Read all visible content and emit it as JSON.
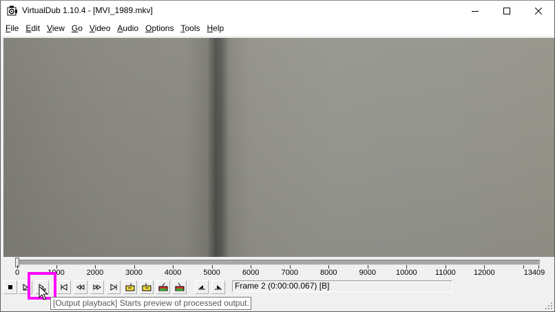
{
  "window": {
    "title": "VirtualDub 1.10.4 - [MVI_1989.mkv]",
    "app_icon": "virtualdub-icon",
    "min_icon": "minimize-icon",
    "max_icon": "maximize-icon",
    "close_icon": "close-icon"
  },
  "menu": [
    {
      "label": "File",
      "accel": "F",
      "rest": "ile"
    },
    {
      "label": "Edit",
      "accel": "E",
      "rest": "dit"
    },
    {
      "label": "View",
      "accel": "V",
      "rest": "iew"
    },
    {
      "label": "Go",
      "accel": "G",
      "rest": "o"
    },
    {
      "label": "Video",
      "accel": "V",
      "rest": "ideo"
    },
    {
      "label": "Audio",
      "accel": "A",
      "rest": "udio"
    },
    {
      "label": "Options",
      "accel": "O",
      "rest": "ptions"
    },
    {
      "label": "Tools",
      "accel": "T",
      "rest": "ools"
    },
    {
      "label": "Help",
      "accel": "H",
      "rest": "elp"
    }
  ],
  "timeline": {
    "current_frame": 2,
    "total_frames": 13409,
    "tick_labels": [
      "0",
      "1000",
      "2000",
      "3000",
      "4000",
      "5000",
      "6000",
      "7000",
      "8000",
      "9000",
      "10000",
      "11000",
      "12000",
      "13409"
    ]
  },
  "toolbar": {
    "buttons": [
      {
        "name": "stop-button",
        "icon": "stop-icon",
        "glyph": "■"
      },
      {
        "name": "input-playback-button",
        "icon": "play-input-icon",
        "glyph": "▶"
      },
      {
        "name": "output-playback-button",
        "icon": "play-output-icon",
        "glyph": "▶"
      },
      {
        "name": "go-to-start-button",
        "icon": "start-icon",
        "glyph": "|◀"
      },
      {
        "name": "previous-frame-button",
        "icon": "rewind-icon",
        "glyph": "◀◀"
      },
      {
        "name": "next-frame-button",
        "icon": "forward-icon",
        "glyph": "▶▶"
      },
      {
        "name": "go-to-end-button",
        "icon": "end-icon",
        "glyph": "▶|"
      },
      {
        "name": "previous-keyframe-button",
        "icon": "prev-key-icon",
        "glyph": "key"
      },
      {
        "name": "next-keyframe-button",
        "icon": "next-key-icon",
        "glyph": "key"
      },
      {
        "name": "previous-scene-button",
        "icon": "prev-scene-icon",
        "glyph": "scene"
      },
      {
        "name": "next-scene-button",
        "icon": "next-scene-icon",
        "glyph": "scene"
      },
      {
        "name": "mark-in-button",
        "icon": "mark-in-icon",
        "glyph": "mark"
      },
      {
        "name": "mark-out-button",
        "icon": "mark-out-icon",
        "glyph": "mark"
      }
    ],
    "frame_status": "Frame 2 (0:00:00.067) [B]"
  },
  "tooltip": {
    "text": "[Output playback] Starts preview of processed output."
  },
  "colors": {
    "highlight": "#ff00ff",
    "title_bg": "#ffffff",
    "window_bg": "#f0f0f0"
  }
}
